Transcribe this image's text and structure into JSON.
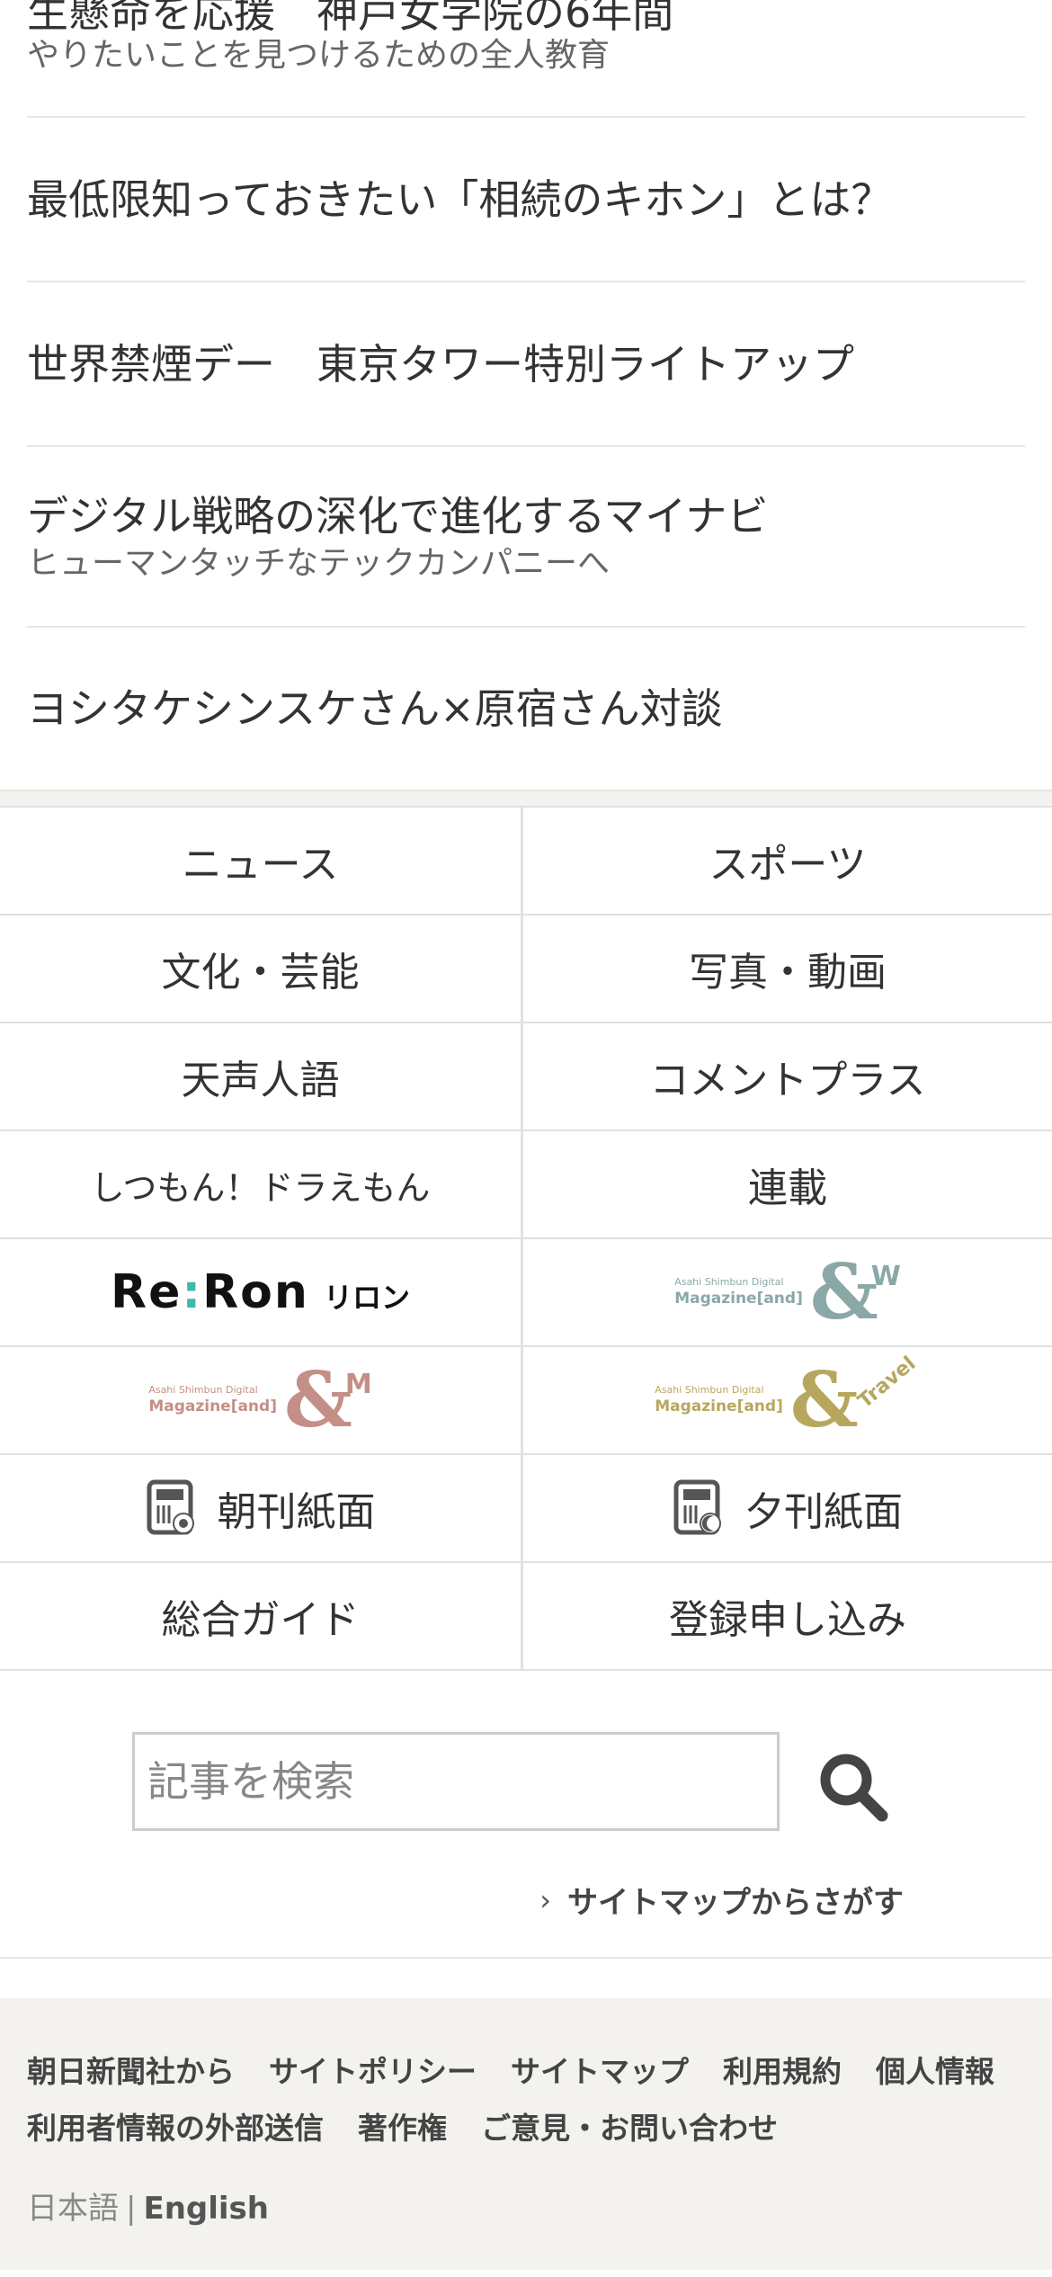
{
  "articles": [
    {
      "title": "生懸命を応援　神戸女学院の6年間",
      "sub": "やりたいことを見つけるための全人教育"
    },
    {
      "title": "最低限知っておきたい「相続のキホン」とは？"
    },
    {
      "title": "世界禁煙デー　東京タワー特別ライトアップ"
    },
    {
      "title": "デジタル戦略の深化で進化するマイナビ",
      "sub": "ヒューマンタッチなテックカンパニーへ"
    },
    {
      "title": "ヨシタケシンスケさん×原宿さん対談"
    }
  ],
  "nav": {
    "news": "ニュース",
    "sports": "スポーツ",
    "culture": "文化・芸能",
    "photo_video": "写真・動画",
    "tensei": "天声人語",
    "comment_plus": "コメントプラス",
    "doraemon": "しつもん！ドラえもん",
    "serial": "連載",
    "reron": {
      "brand": "Re:Ron",
      "kana": "リロン"
    },
    "andw": {
      "line1": "Asahi Shimbun Digital",
      "line2": "Magazine[and]",
      "mark": "&",
      "suffix": "W",
      "color": "#8aa8a6"
    },
    "andm": {
      "line1": "Asahi Shimbun Digital",
      "line2": "Magazine[and]",
      "mark": "&",
      "suffix": "M",
      "color": "#c38f86"
    },
    "andtravel": {
      "line1": "Asahi Shimbun Digital",
      "line2": "Magazine[and]",
      "mark": "&",
      "suffix": "Travel",
      "color": "#b7a75e"
    },
    "morning": "朝刊紙面",
    "evening": "夕刊紙面",
    "guide": "総合ガイド",
    "register": "登録申し込み"
  },
  "search": {
    "placeholder": "記事を検索",
    "sitemap_link": "サイトマップからさがす"
  },
  "footer": {
    "links": [
      "朝日新聞社から",
      "サイトポリシー",
      "サイトマップ",
      "利用規約",
      "個人情報",
      "利用者情報の外部送信",
      "著作権",
      "ご意見・お問い合わせ"
    ],
    "lang_ja": "日本語",
    "lang_sep": "|",
    "lang_en": "English"
  }
}
